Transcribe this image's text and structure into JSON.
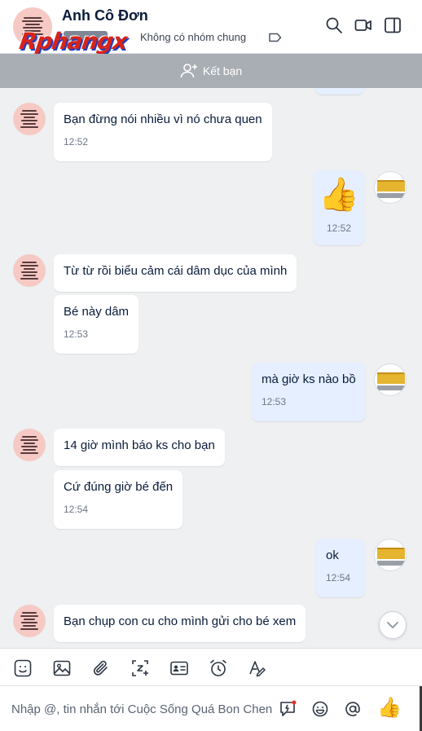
{
  "header": {
    "contact_name": "Anh Cô Đơn",
    "subtitle": "Không có nhóm chung",
    "watermark": "Rphangx"
  },
  "friend_bar": {
    "label": "Kết bạn"
  },
  "messages": [
    {
      "side": "in",
      "text": "Bạn đừng nói nhiều vì nó chưa quen",
      "time": "12:52"
    },
    {
      "side": "out",
      "text": "👍",
      "time": "12:52"
    },
    {
      "side": "in",
      "text": "Từ từ rồi biểu cảm cái dâm dục của mình",
      "time": ""
    },
    {
      "side": "in",
      "text": "Bé này dâm",
      "time": "12:53"
    },
    {
      "side": "out",
      "text": "mà giờ ks nào bồ",
      "time": "12:53"
    },
    {
      "side": "in",
      "text": "14 giờ mình báo ks cho bạn",
      "time": ""
    },
    {
      "side": "in",
      "text": "Cứ đúng giờ bé đến",
      "time": "12:54"
    },
    {
      "side": "out",
      "text": "ok",
      "time": "12:54"
    },
    {
      "side": "in",
      "text": "Bạn chụp con cu cho mình gửi cho bé xem",
      "time": ""
    }
  ],
  "composer": {
    "placeholder": "Nhập @, tin nhắn tới Cuộc Sống Quá Bon Chen",
    "send_reaction": "👍"
  },
  "toolbar": {
    "icons": [
      "sticker-icon",
      "image-icon",
      "attachment-icon",
      "screenshot-icon",
      "contact-card-icon",
      "reminder-icon",
      "text-format-icon"
    ]
  },
  "colors": {
    "outgoing_bubble": "#e5efff",
    "incoming_bubble": "#ffffff",
    "friend_bar": "#a9aeb5",
    "chat_background": "#eef0f1"
  }
}
